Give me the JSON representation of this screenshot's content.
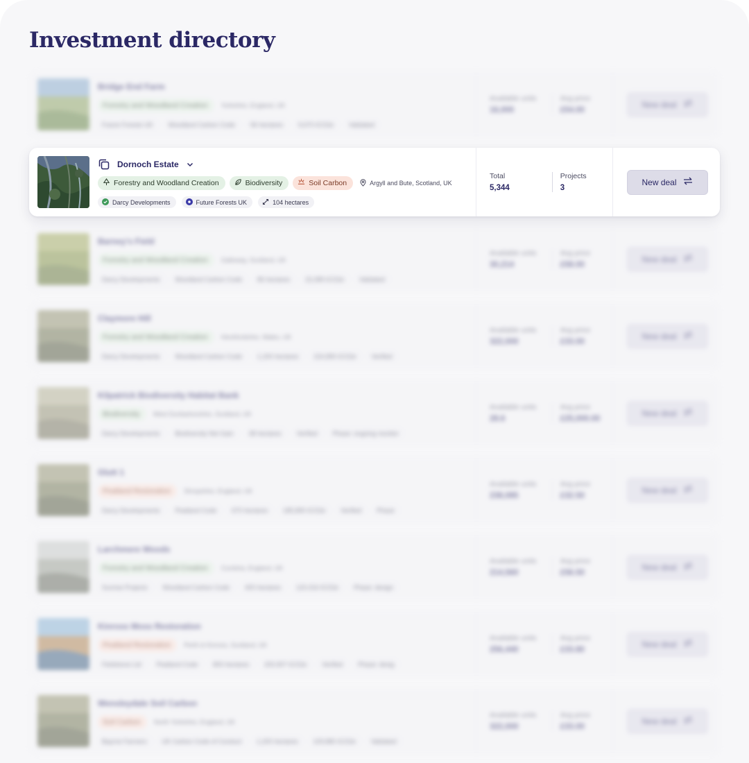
{
  "page": {
    "title": "Investment directory"
  },
  "focus": {
    "name": "Dornoch Estate",
    "tags": [
      {
        "label": "Forestry and Woodland Creation",
        "kind": "green",
        "icon": "tree-icon"
      },
      {
        "label": "Biodiversity",
        "kind": "green",
        "icon": "leaf-icon"
      },
      {
        "label": "Soil Carbon",
        "kind": "orange",
        "icon": "sun-icon"
      }
    ],
    "location": "Argyll and Bute, Scotland, UK",
    "meta": [
      {
        "label": "Darcy Developments",
        "icon": "check-circle-icon",
        "color": "#3f9a5a"
      },
      {
        "label": "Future Forests UK",
        "icon": "org-dot-icon",
        "color": "#3b3aa8"
      },
      {
        "label": "104 hectares",
        "icon": "ruler-icon"
      }
    ],
    "stats": [
      {
        "label": "Total",
        "value": "5,344"
      },
      {
        "label": "Projects",
        "value": "3"
      }
    ],
    "button_label": "New deal"
  },
  "rows": [
    {
      "name": "Bridge End Farm",
      "tag": "Forestry and Woodland Creation",
      "tag_kind": "green",
      "location": "Yorkshire, England, UK",
      "meta": [
        "Future Forests UK",
        "Woodland Carbon Code",
        "96 hectares",
        "9,670 tCO2e",
        "Validated"
      ],
      "units": "16,000",
      "price": "£54.00",
      "units_label": "Available units",
      "price_label": "Avg price",
      "button": "New deal",
      "img": "meadow"
    },
    {
      "name": "Barney's Field",
      "tag": "Forestry and Woodland Creation",
      "tag_kind": "green",
      "location": "Galloway, Scotland, UK",
      "meta": [
        "Darcy Developments",
        "Woodland Carbon Code",
        "86 hectares",
        "15,089 tCO2e",
        "Validated"
      ],
      "units": "30,214",
      "price": "£58.00",
      "units_label": "Available units",
      "price_label": "Avg price",
      "button": "New deal",
      "img": "field"
    },
    {
      "name": "Claymore Hill",
      "tag": "Forestry and Woodland Creation",
      "tag_kind": "green",
      "location": "Herefordshire, Wales, UK",
      "meta": [
        "Darcy Developments",
        "Woodland Carbon Code",
        "1,200 hectares",
        "224,890 tCO2e",
        "Verified"
      ],
      "units": "322,000",
      "price": "£33.00",
      "units_label": "Available units",
      "price_label": "Avg price",
      "button": "New deal",
      "img": "forest"
    },
    {
      "name": "Kilpatrick Biodiversity Habitat Bank",
      "tag": "Biodiversity",
      "tag_kind": "green",
      "location": "West Dunbartonshire, Scotland, UK",
      "meta": [
        "Darcy Developments",
        "Biodiversity Net Gain",
        "38 hectares",
        "Verified",
        "Phase: ongoing monitor"
      ],
      "units": "28.6",
      "price": "£25,000.00",
      "units_label": "Available units",
      "price_label": "Avg price",
      "button": "New deal",
      "img": "heath"
    },
    {
      "name": "Glutt 1",
      "tag": "Peatland Restoration",
      "tag_kind": "orange",
      "location": "Shropshire, England, UK",
      "meta": [
        "Darcy Developments",
        "Peatland Code",
        "670 hectares",
        "185,890 tCO2e",
        "Verified",
        "Phase"
      ],
      "units": "238,085",
      "price": "£32.50",
      "units_label": "Available units",
      "price_label": "Avg price",
      "button": "New deal",
      "img": "forest"
    },
    {
      "name": "Larchmere Woods",
      "tag": "Forestry and Woodland Creation",
      "tag_kind": "green",
      "location": "Cumbria, England, UK",
      "meta": [
        "Sunrise Projects",
        "Woodland Carbon Code",
        "400 hectares",
        "120,016 tCO2e",
        "Phase: design"
      ],
      "units": "214,560",
      "price": "£56.50",
      "units_label": "Available units",
      "price_label": "Avg price",
      "button": "New deal",
      "img": "birch"
    },
    {
      "name": "Kinross Moss Restoration",
      "tag": "Peatland Restoration",
      "tag_kind": "orange",
      "location": "Perth & Kinross, Scotland, UK",
      "meta": [
        "Fieldstone Ltd",
        "Peatland Code",
        "800 hectares",
        "200,907 tCO2e",
        "Verified",
        "Phase: desig"
      ],
      "units": "256,440",
      "price": "£33.80",
      "units_label": "Available units",
      "price_label": "Avg price",
      "button": "New deal",
      "img": "moss"
    },
    {
      "name": "Wensleydale Soil Carbon",
      "tag": "Soil Carbon",
      "tag_kind": "orange",
      "location": "North Yorkshire, England, UK",
      "meta": [
        "Bayrne Farmers",
        "UK Carbon Code of Conduct",
        "1,200 hectares",
        "109,880 tCO2e",
        "Validated"
      ],
      "units": "322,000",
      "price": "£33.00",
      "units_label": "Available units",
      "price_label": "Avg price",
      "button": "New deal",
      "img": "forest"
    }
  ]
}
